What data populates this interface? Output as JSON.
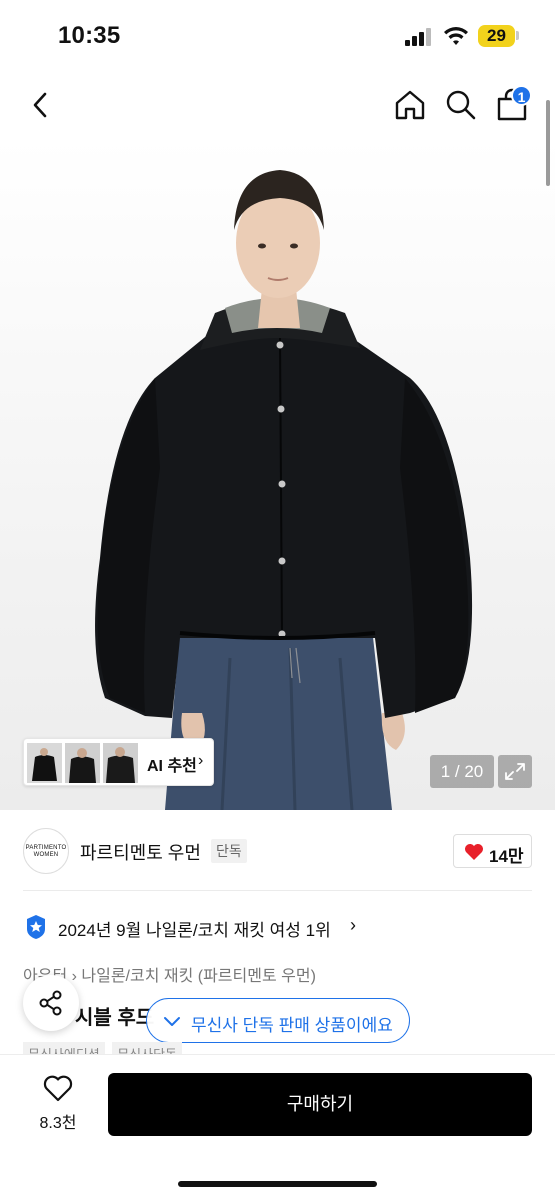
{
  "status_bar": {
    "time": "10:35",
    "battery": "29"
  },
  "nav": {
    "cart_count": "1"
  },
  "gallery": {
    "ai_label": "AI 추천",
    "chevron": "›",
    "page_counter": "1 / 20"
  },
  "brand": {
    "logo_line1": "PARTIMENTO",
    "logo_line2": "WOMEN",
    "name": "파르티멘토 우먼",
    "tag": "단독",
    "like_count": "14만"
  },
  "ranking": {
    "text": "2024년 9월 나일론/코치 재킷 여성 1위",
    "chevron": "›"
  },
  "breadcrumb": "아우터 › 나일론/코치 재킷 (파르티멘토 우먼)",
  "product": {
    "title_visible": "시블 후드"
  },
  "toast": {
    "text": "무신사 단독 판매 상품이에요"
  },
  "tags": [
    "무신사에디션",
    "무신사단독"
  ],
  "bottom": {
    "wish_count": "8.3천",
    "buy_label": "구매하기"
  },
  "colors": {
    "accent": "#1f72e8",
    "heart": "#e8202a",
    "buy": "#000000"
  }
}
